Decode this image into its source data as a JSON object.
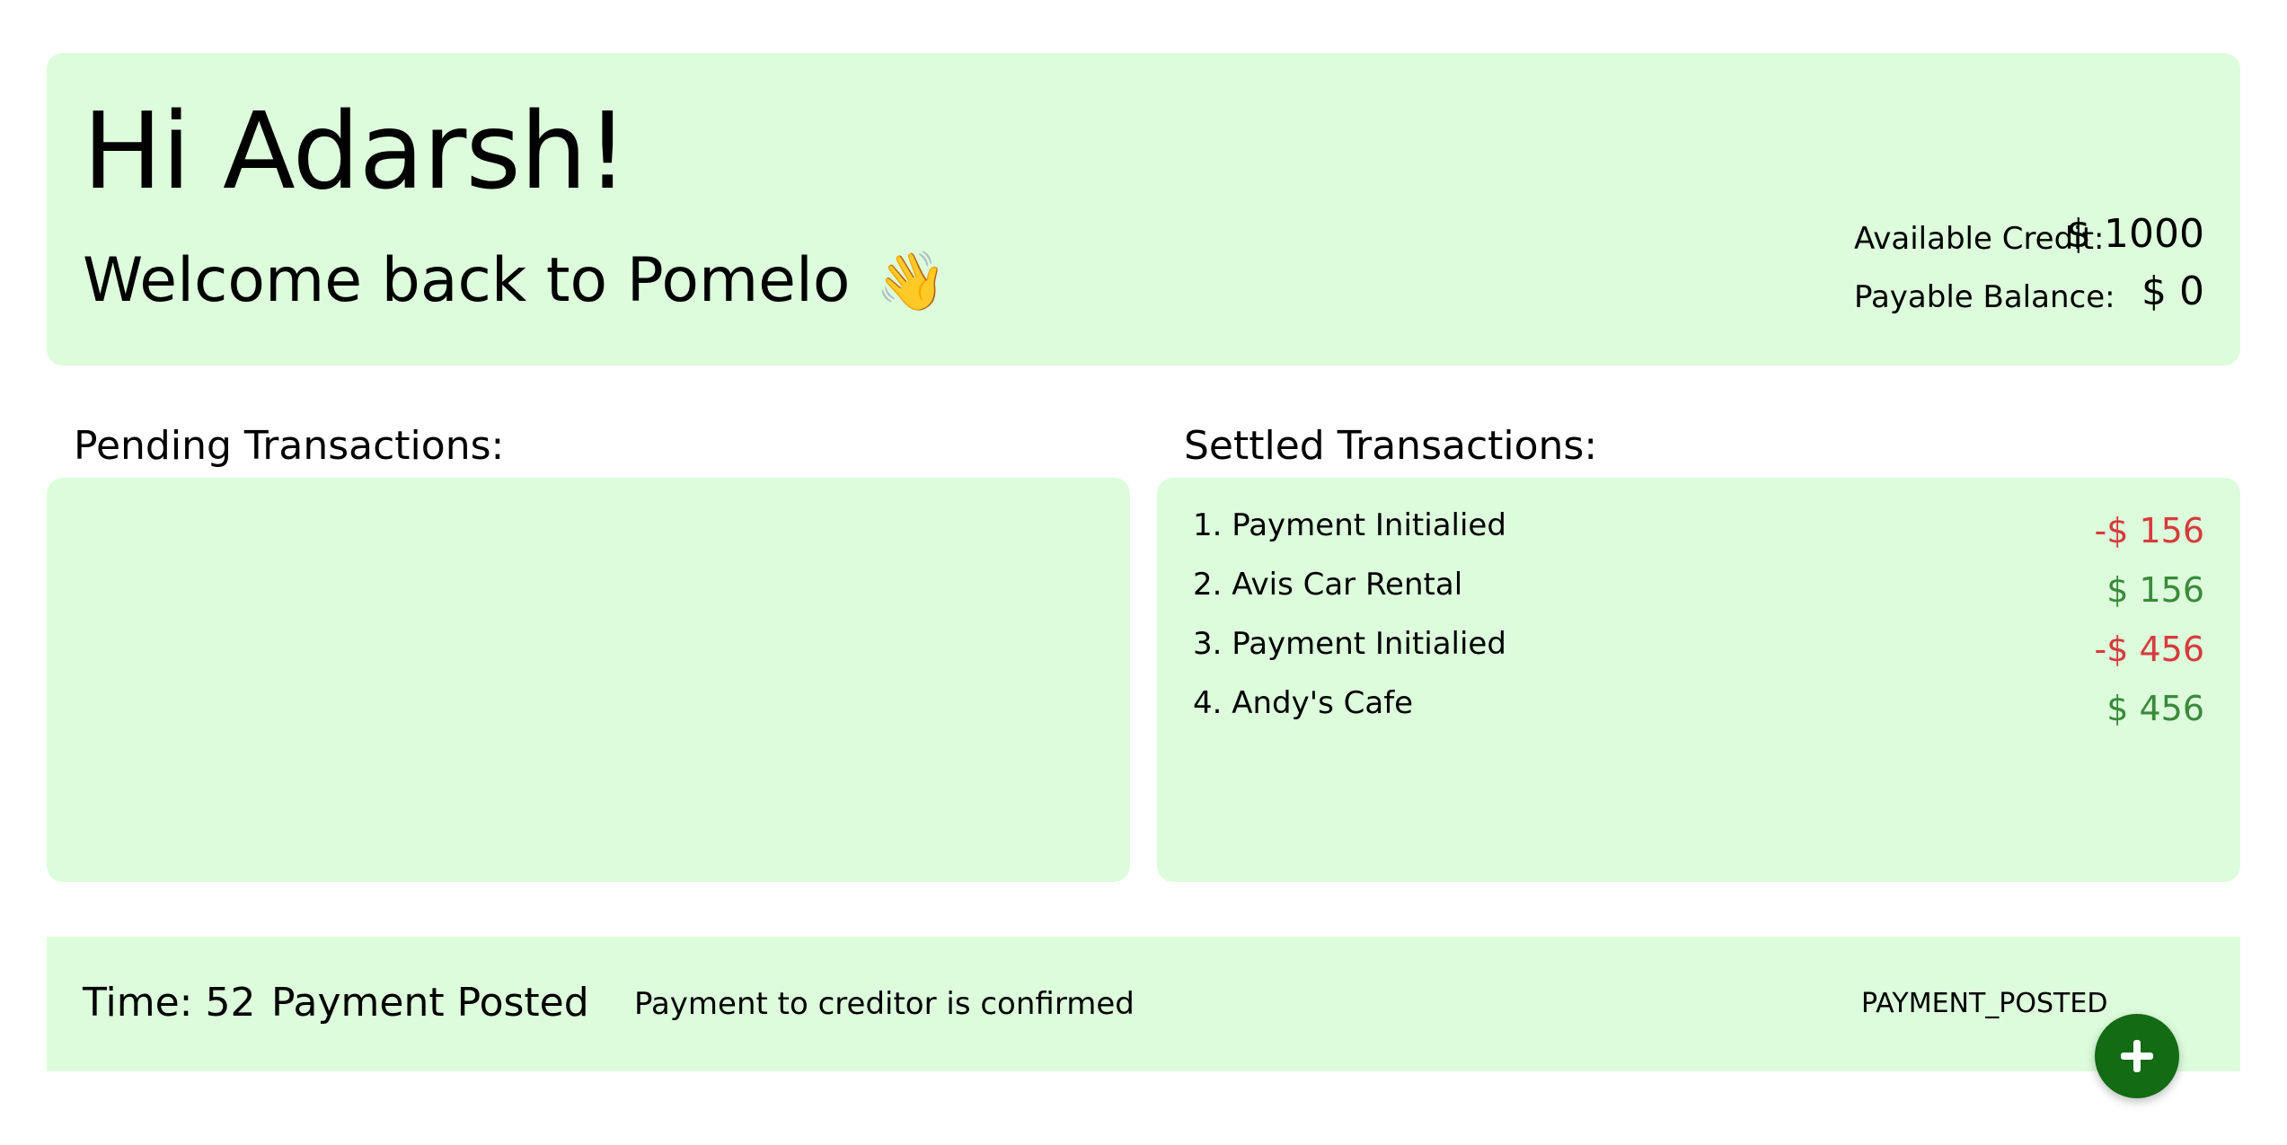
{
  "header": {
    "greeting": "Hi Adarsh!",
    "welcome": "Welcome back to Pomelo",
    "wave_emoji": "👋",
    "available_credit_label": "Available Credit:",
    "available_credit_value": "$ 1000",
    "payable_balance_label": "Payable Balance:",
    "payable_balance_value": "$ 0"
  },
  "pending": {
    "title": "Pending Transactions:",
    "items": []
  },
  "settled": {
    "title": "Settled Transactions:",
    "items": [
      {
        "label": "1. Payment Initialied",
        "amount": "-$ 156",
        "sign": "negative"
      },
      {
        "label": "2. Avis Car Rental",
        "amount": "$ 156",
        "sign": "positive"
      },
      {
        "label": "3. Payment Initialied",
        "amount": "-$ 456",
        "sign": "negative"
      },
      {
        "label": "4. Andy's Cafe",
        "amount": "$ 456",
        "sign": "positive"
      }
    ]
  },
  "event": {
    "time": "Time: 52",
    "title": "Payment Posted",
    "description": "Payment to creditor is confirmed",
    "code": "PAYMENT_POSTED"
  },
  "fab": {
    "icon": "plus-icon"
  },
  "colors": {
    "panel_bg": "#dcfcdc",
    "negative": "#d63b3b",
    "positive": "#3a8a3a",
    "fab_bg": "#136b13"
  }
}
